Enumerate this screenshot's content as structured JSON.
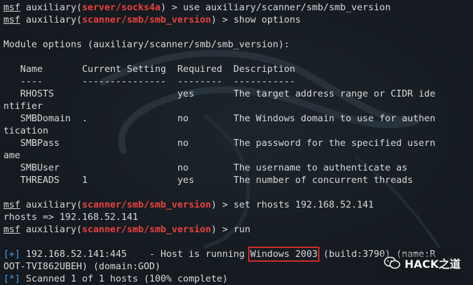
{
  "terminal": {
    "prompt": "msf",
    "context_word": "auxiliary",
    "lines": [
      {
        "type": "cmd",
        "module": "server/socks4a",
        "command": "use auxiliary/scanner/smb/smb_version"
      },
      {
        "type": "cmd",
        "module": "scanner/smb/smb_version",
        "command": "show options"
      },
      {
        "type": "text",
        "text": ""
      },
      {
        "type": "text",
        "text": "Module options (auxiliary/scanner/smb/smb_version):"
      },
      {
        "type": "text",
        "text": ""
      },
      {
        "type": "text",
        "text": "   Name       Current Setting  Required  Description"
      },
      {
        "type": "text",
        "text": "   ----       ---------------  --------  -----------"
      },
      {
        "type": "text",
        "text": "   RHOSTS                      yes       The target address range or CIDR ide"
      },
      {
        "type": "text",
        "text": "ntifier"
      },
      {
        "type": "text",
        "text": "   SMBDomain  .                no        The Windows domain to use for authen"
      },
      {
        "type": "text",
        "text": "tication"
      },
      {
        "type": "text",
        "text": "   SMBPass                     no        The password for the specified usern"
      },
      {
        "type": "text",
        "text": "ame"
      },
      {
        "type": "text",
        "text": "   SMBUser                     no        The username to authenticate as"
      },
      {
        "type": "text",
        "text": "   THREADS    1                yes       The number of concurrent threads"
      },
      {
        "type": "text",
        "text": ""
      },
      {
        "type": "cmd",
        "module": "scanner/smb/smb_version",
        "command": "set rhosts 192.168.52.141"
      },
      {
        "type": "text",
        "text": "rhosts => 192.168.52.141"
      },
      {
        "type": "cmd",
        "module": "scanner/smb/smb_version",
        "command": "run"
      },
      {
        "type": "text",
        "text": ""
      },
      {
        "type": "result",
        "marker": "[+]",
        "before": " 192.168.52.141:445    - Host is running ",
        "highlight": "Windows 2003",
        "after": " (build:3790) (name:R"
      },
      {
        "type": "text",
        "text": "OOT-TVI862UBEH) (domain:GOD)"
      },
      {
        "type": "result",
        "marker": "[*]",
        "before": " Scanned 1 of 1 hosts (100% complete)",
        "highlight": "",
        "after": ""
      }
    ]
  },
  "watermark": {
    "text": "HACK之道",
    "icon": "wechat-icon"
  },
  "colors": {
    "background": "#141a1f",
    "text": "#d9d9d9",
    "module": "#e8423f",
    "marker": "#4a9be6",
    "highlight_box": "#d42a2a"
  }
}
